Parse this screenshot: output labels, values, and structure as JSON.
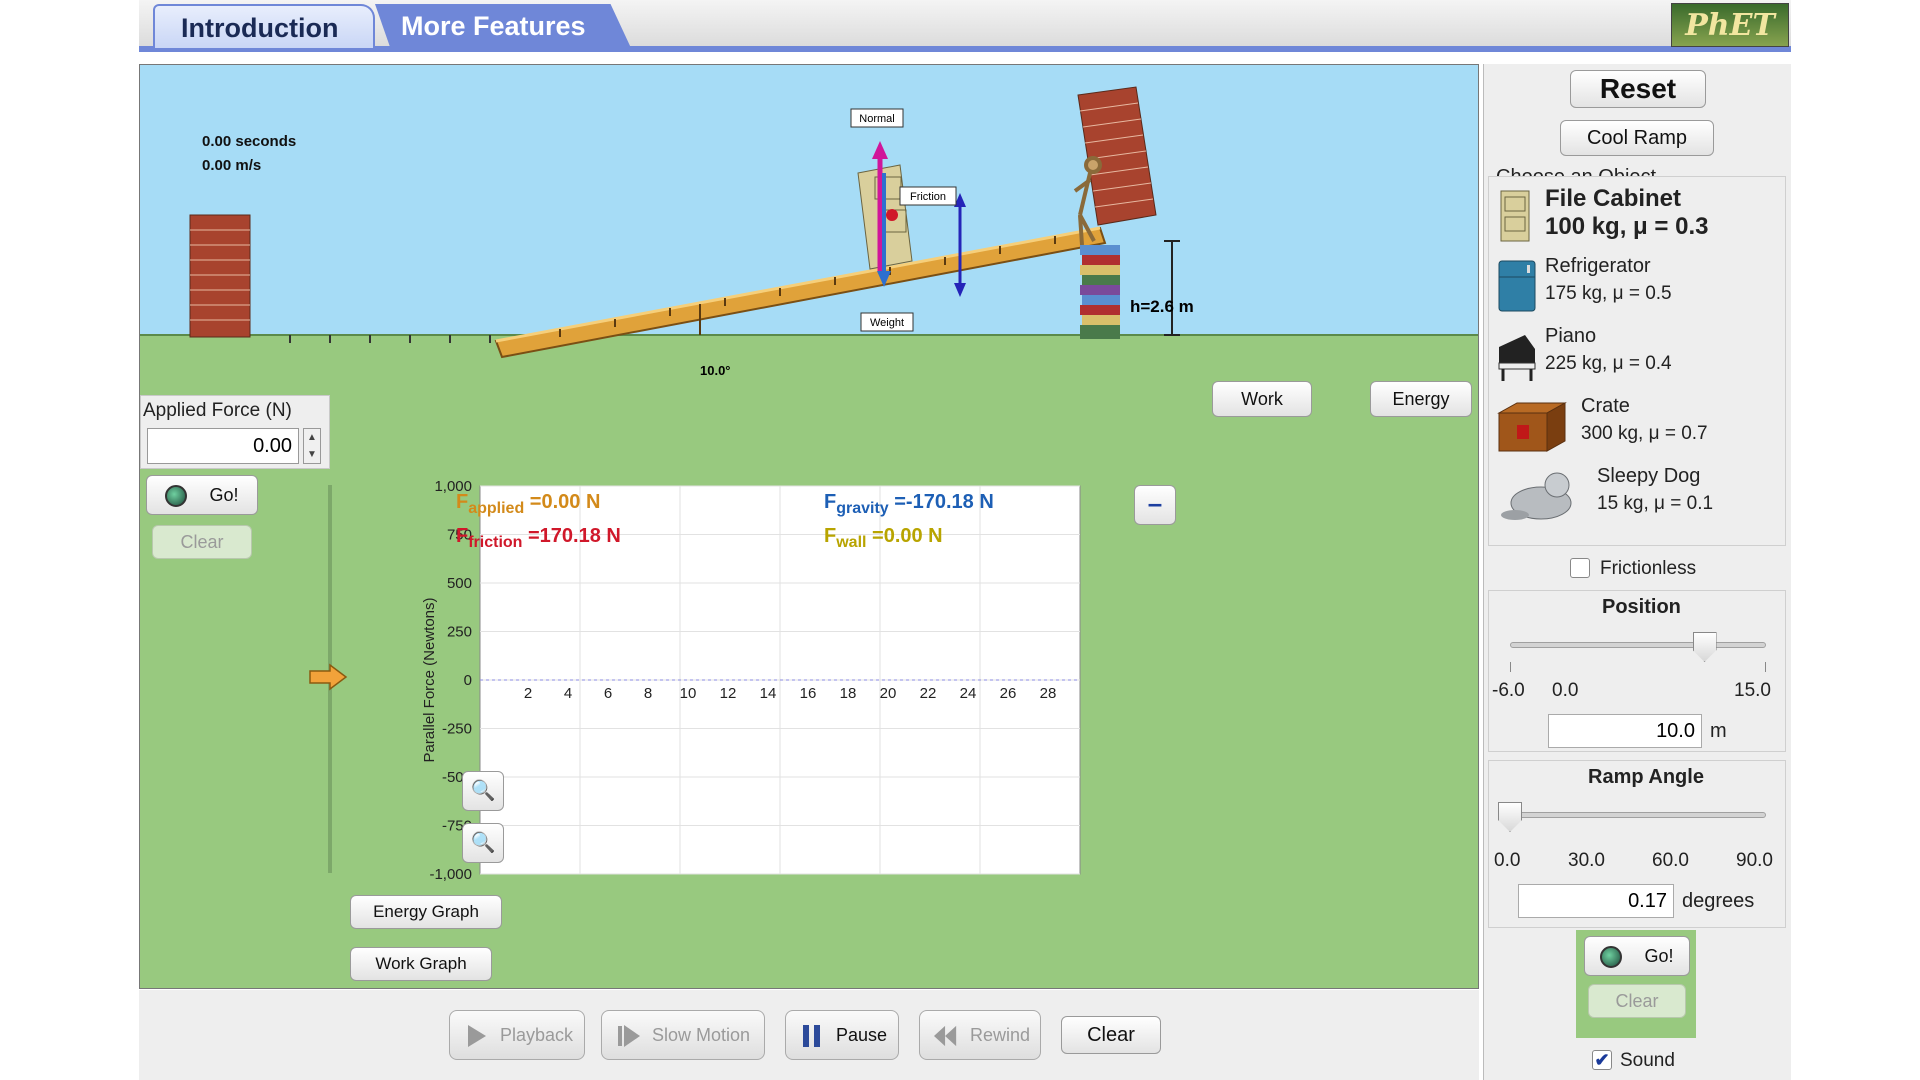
{
  "tabs": [
    "Introduction",
    "More Features"
  ],
  "logo_text": "PhET",
  "scene": {
    "time_readout": "0.00 seconds",
    "speed_readout": "0.00 m/s",
    "label_normal": "Normal",
    "label_friction": "Friction",
    "label_weight": "Weight",
    "angle_label": "10.0°",
    "height_label": "h=2.6 m",
    "work_button": "Work",
    "energy_button": "Energy"
  },
  "applied_force": {
    "label": "Applied Force (N)",
    "value": "0.00",
    "go_label": "Go!",
    "clear_label": "Clear"
  },
  "graph": {
    "ylabel": "Parallel Force (Newtons)",
    "y_ticks": [
      "1,000",
      "750",
      "500",
      "250",
      "0",
      "-250",
      "-500",
      "-750",
      "-1,000"
    ],
    "x_ticks": [
      "2",
      "4",
      "6",
      "8",
      "10",
      "12",
      "14",
      "16",
      "18",
      "20",
      "22",
      "24",
      "26",
      "28"
    ],
    "legend": {
      "applied_sub": "applied",
      "applied_val": "=0.00 N",
      "friction_sub": "friction",
      "friction_val": "=170.18 N",
      "gravity_sub": "gravity",
      "gravity_val": "=-170.18 N",
      "wall_sub": "wall",
      "wall_val": "=0.00 N",
      "f": "F"
    },
    "minimize_label": "–",
    "energy_graph_button": "Energy Graph",
    "work_graph_button": "Work Graph"
  },
  "right_panel": {
    "reset_label": "Reset",
    "cool_ramp_label": "Cool Ramp",
    "choose_object_label": "Choose an Object",
    "objects": [
      {
        "name": "File Cabinet",
        "spec": "100 kg, μ = 0.3",
        "icon": "file-cabinet-icon"
      },
      {
        "name": "Refrigerator",
        "spec": "175 kg, μ = 0.5",
        "icon": "refrigerator-icon"
      },
      {
        "name": "Piano",
        "spec": "225 kg, μ = 0.4",
        "icon": "piano-icon"
      },
      {
        "name": "Crate",
        "spec": "300 kg, μ = 0.7",
        "icon": "crate-icon"
      },
      {
        "name": "Sleepy Dog",
        "spec": "15 kg, μ = 0.1",
        "icon": "dog-icon"
      }
    ],
    "frictionless_label": "Frictionless",
    "frictionless_checked": false,
    "position": {
      "title": "Position",
      "tick_labels": [
        "-6.0",
        "0.0",
        "15.0"
      ],
      "value": "10.0",
      "unit": "m",
      "level_fraction": 0.76
    },
    "ramp_angle": {
      "title": "Ramp Angle",
      "tick_labels": [
        "0.0",
        "30.0",
        "60.0",
        "90.0"
      ],
      "value": "0.17",
      "unit": "degrees",
      "level_fraction": 0.0
    },
    "go_label": "Go!",
    "clear_label": "Clear",
    "sound_label": "Sound",
    "sound_checked": true
  },
  "playback": {
    "playback": "Playback",
    "slow_motion": "Slow Motion",
    "pause": "Pause",
    "rewind": "Rewind",
    "clear": "Clear"
  },
  "colors": {
    "sky": "#a6dcf6",
    "ground": "#98c97f",
    "ramp": "#e0a23a",
    "applied": "#d38a1a",
    "friction": "#d0182a",
    "gravity": "#1d5fb5",
    "wall": "#b8a400",
    "tab_accent": "#6f87d8"
  }
}
